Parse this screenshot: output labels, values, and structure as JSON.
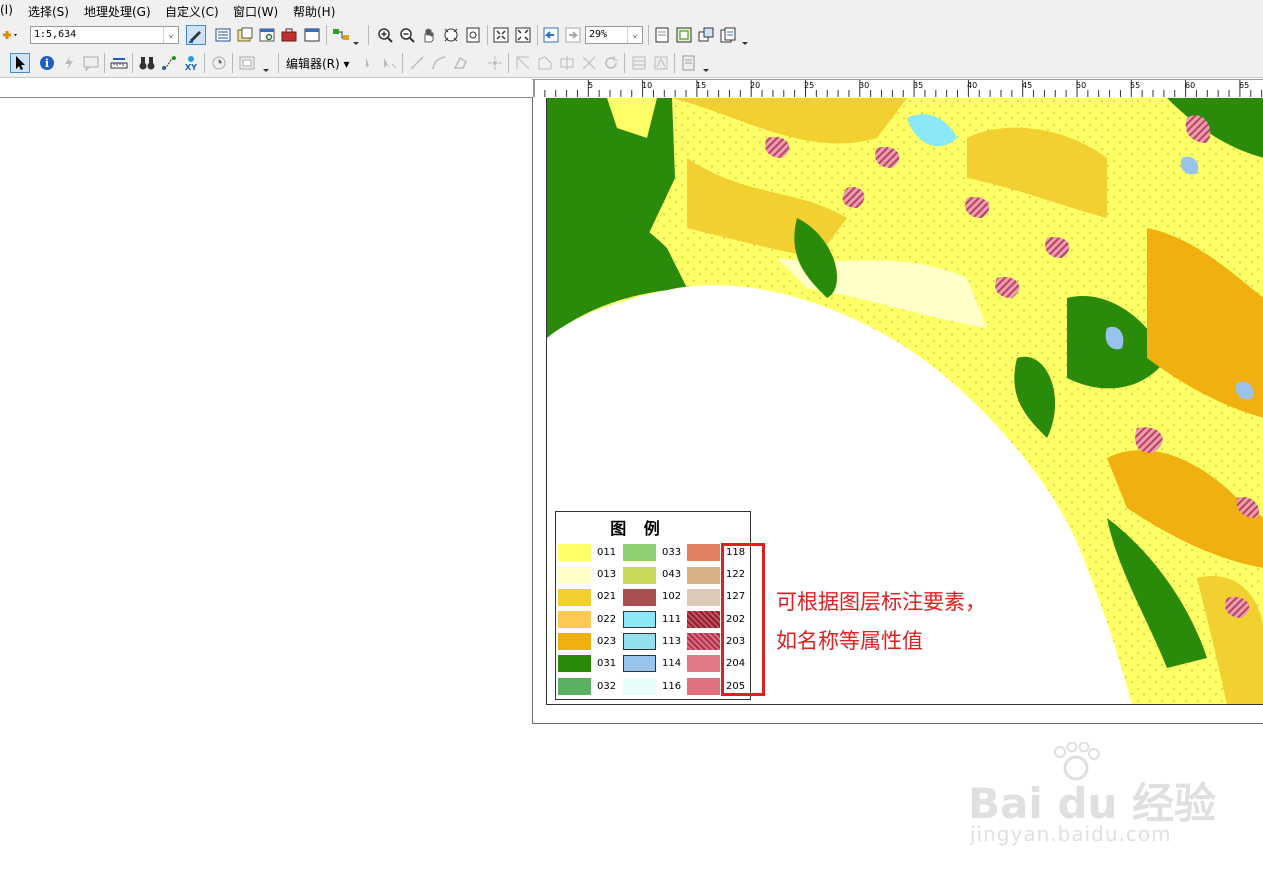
{
  "menu": [
    {
      "label": "(I)"
    },
    {
      "label": "选择(S)"
    },
    {
      "label": "地理处理(G)"
    },
    {
      "label": "自定义(C)"
    },
    {
      "label": "窗口(W)"
    },
    {
      "label": "帮助(H)"
    }
  ],
  "toolbar": {
    "scale_value": "1:5,634",
    "zoom_value": "29%",
    "editor_label": "编辑器(R)"
  },
  "ruler": {
    "ticks": [
      "5",
      "10",
      "15",
      "20",
      "25",
      "30",
      "35",
      "40",
      "45",
      "50",
      "55",
      "60",
      "65"
    ]
  },
  "legend": {
    "title": "图 例",
    "items": [
      {
        "code": "011",
        "color": "#ffff66"
      },
      {
        "code": "013",
        "color": "#ffffc8"
      },
      {
        "code": "021",
        "color": "#f2d030"
      },
      {
        "code": "022",
        "color": "#ffc850"
      },
      {
        "code": "023",
        "color": "#f0b010"
      },
      {
        "code": "031",
        "color": "#2a8a0a"
      },
      {
        "code": "032",
        "color": "#5ab060"
      },
      {
        "code": "033",
        "color": "#8cd070"
      },
      {
        "code": "043",
        "color": "#c8d858"
      },
      {
        "code": "102",
        "color": "#a85050"
      },
      {
        "code": "111",
        "color": "#8ce8f8"
      },
      {
        "code": "113",
        "color": "#90e0f0"
      },
      {
        "code": "114",
        "color": "#98c4ec"
      },
      {
        "code": "116",
        "color": "#e8fcfc"
      },
      {
        "code": "118",
        "color": "#e08060"
      },
      {
        "code": "122",
        "color": "#d8b088"
      },
      {
        "code": "127",
        "color": "#dccab8"
      },
      {
        "code": "202",
        "color": "#c85060"
      },
      {
        "code": "203",
        "color": "#d87080"
      },
      {
        "code": "204",
        "color": "#e07888"
      },
      {
        "code": "205",
        "color": "#e07080"
      }
    ]
  },
  "annotation": {
    "line1": "可根据图层标注要素，",
    "line2": "如名称等属性值"
  },
  "watermark": {
    "brand": "Bai du 经验",
    "url": "jingyan.baidu.com"
  },
  "colors": {
    "annotation_red": "#e02020",
    "forest_green": "#2a8a0a",
    "field_yellow": "#ffff66"
  }
}
